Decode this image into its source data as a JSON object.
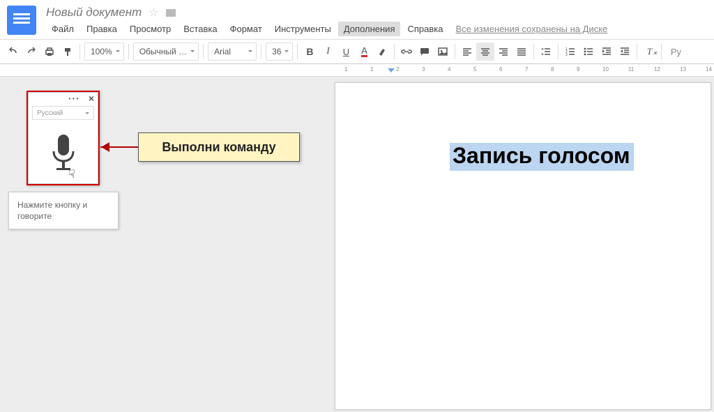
{
  "header": {
    "doc_title": "Новый документ",
    "menu": [
      "Файл",
      "Правка",
      "Просмотр",
      "Вставка",
      "Формат",
      "Инструменты",
      "Дополнения",
      "Справка"
    ],
    "active_menu_index": 6,
    "save_status": "Все изменения сохранены на Диске"
  },
  "toolbar": {
    "zoom": "100%",
    "style": "Обычный …",
    "font": "Arial",
    "font_size": "36"
  },
  "voice": {
    "language": "Русский",
    "tooltip": "Нажмите кнопку и говорите"
  },
  "callout": {
    "text": "Выполни команду"
  },
  "document": {
    "text": "Запись голосом"
  },
  "ruler": {
    "ticks": [
      -1,
      1,
      2,
      3,
      4,
      5,
      6,
      7,
      8,
      9,
      10,
      11,
      12,
      13,
      14
    ]
  }
}
